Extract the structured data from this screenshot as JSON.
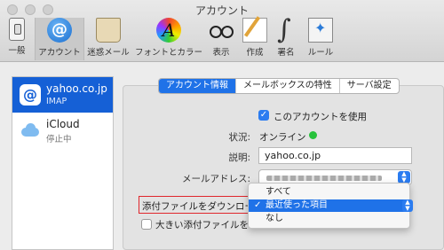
{
  "window": {
    "title": "アカウント"
  },
  "toolbar": {
    "items": [
      {
        "label": "一般",
        "icon": "general-switch-icon"
      },
      {
        "label": "アカウント",
        "icon": "at-sign-icon"
      },
      {
        "label": "迷惑メール",
        "icon": "junk-bin-icon"
      },
      {
        "label": "フォントとカラー",
        "icon": "font-color-icon"
      },
      {
        "label": "表示",
        "icon": "glasses-icon"
      },
      {
        "label": "作成",
        "icon": "compose-pencil-icon"
      },
      {
        "label": "署名",
        "icon": "signature-icon"
      },
      {
        "label": "ルール",
        "icon": "rules-envelope-icon"
      }
    ],
    "account_glyph": "@"
  },
  "sidebar": {
    "accounts": [
      {
        "name": "yahoo.co.jp",
        "type": "IMAP",
        "glyph": "@"
      },
      {
        "name": "iCloud",
        "type": "停止中"
      }
    ]
  },
  "tabs": [
    "アカウント情報",
    "メールボックスの特性",
    "サーバ設定"
  ],
  "form": {
    "use_account_label": "このアカウントを使用",
    "use_account_checked": true,
    "status_label": "状況:",
    "status_value": "オンライン",
    "description_label": "説明:",
    "description_value": "yahoo.co.jp",
    "email_label": "メールアドレス:",
    "attachments_label": "添付ファイルをダウンロード",
    "large_attachments_label": "大きい添付ファイルをMa",
    "check_glyph": "✓"
  },
  "download_menu": {
    "options": [
      "すべて",
      "最近使った項目",
      "なし"
    ],
    "selected_index": 1,
    "tick": "✓"
  },
  "colors": {
    "accent": "#1f72e8",
    "status_online": "#27c23c",
    "highlight_box": "#e0262b"
  }
}
